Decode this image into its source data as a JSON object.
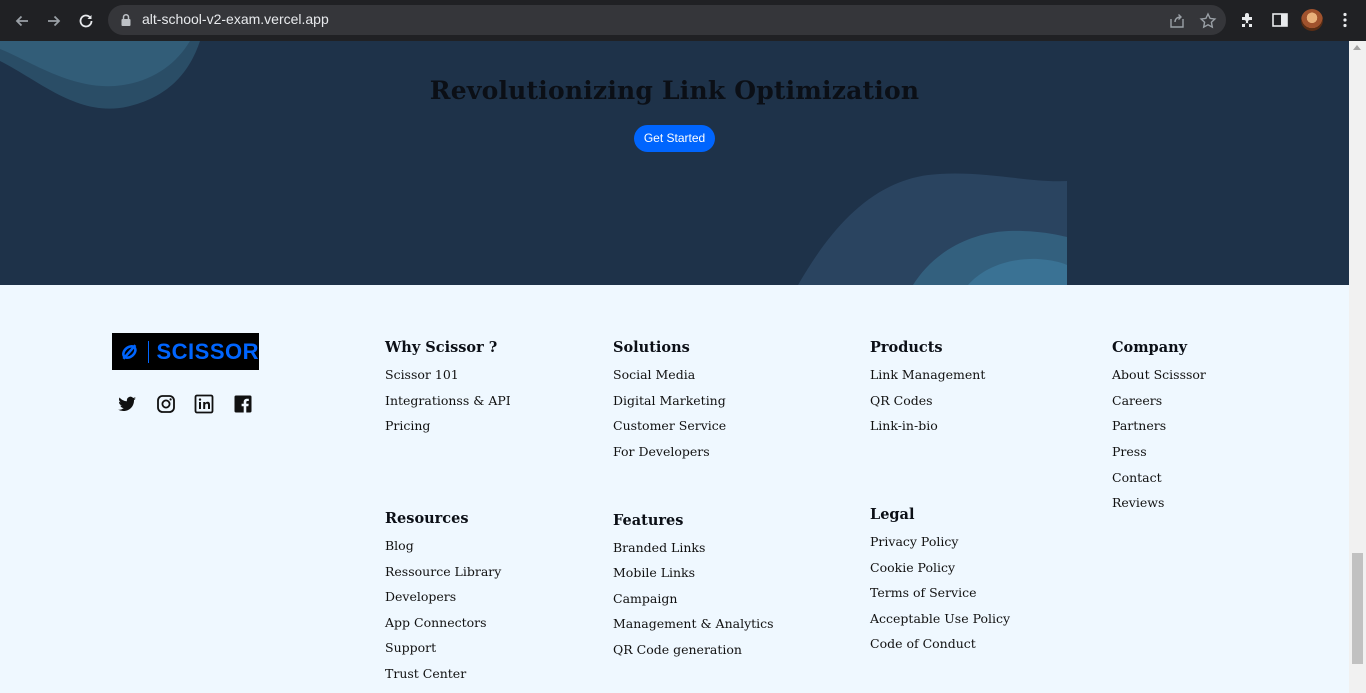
{
  "browser": {
    "url": "alt-school-v2-exam.vercel.app",
    "icons": [
      "back-icon",
      "forward-icon",
      "reload-icon",
      "lock-icon",
      "share-icon",
      "star-icon",
      "extensions-icon",
      "side-panel-icon",
      "avatar",
      "menu-icon"
    ]
  },
  "hero": {
    "title": "Revolutionizing Link Optimization",
    "cta": "Get Started"
  },
  "footer": {
    "brand": "SCISSOR",
    "social": [
      "twitter-icon",
      "instagram-icon",
      "linkedin-icon",
      "facebook-icon"
    ],
    "columns": {
      "why": {
        "title": "Why Scissor ?",
        "links": [
          "Scissor 101",
          "Integrationss & API",
          "Pricing"
        ]
      },
      "solutions": {
        "title": "Solutions",
        "links": [
          "Social Media",
          "Digital Marketing",
          "Customer Service",
          "For Developers"
        ]
      },
      "products": {
        "title": "Products",
        "links": [
          "Link Management",
          "QR Codes",
          "Link-in-bio"
        ]
      },
      "company": {
        "title": "Company",
        "links": [
          "About Scisssor",
          "Careers",
          "Partners",
          "Press",
          "Contact",
          "Reviews"
        ]
      },
      "resources": {
        "title": "Resources",
        "links": [
          "Blog",
          "Ressource Library",
          "Developers",
          "App Connectors",
          "Support",
          "Trust Center"
        ]
      },
      "features": {
        "title": "Features",
        "links": [
          "Branded Links",
          "Mobile Links",
          "Campaign",
          "Management & Analytics",
          "QR Code generation"
        ]
      },
      "legal": {
        "title": "Legal",
        "links": [
          "Privacy Policy",
          "Cookie Policy",
          "Terms of Service",
          "Acceptable Use Policy",
          "Code of Conduct"
        ]
      }
    }
  }
}
